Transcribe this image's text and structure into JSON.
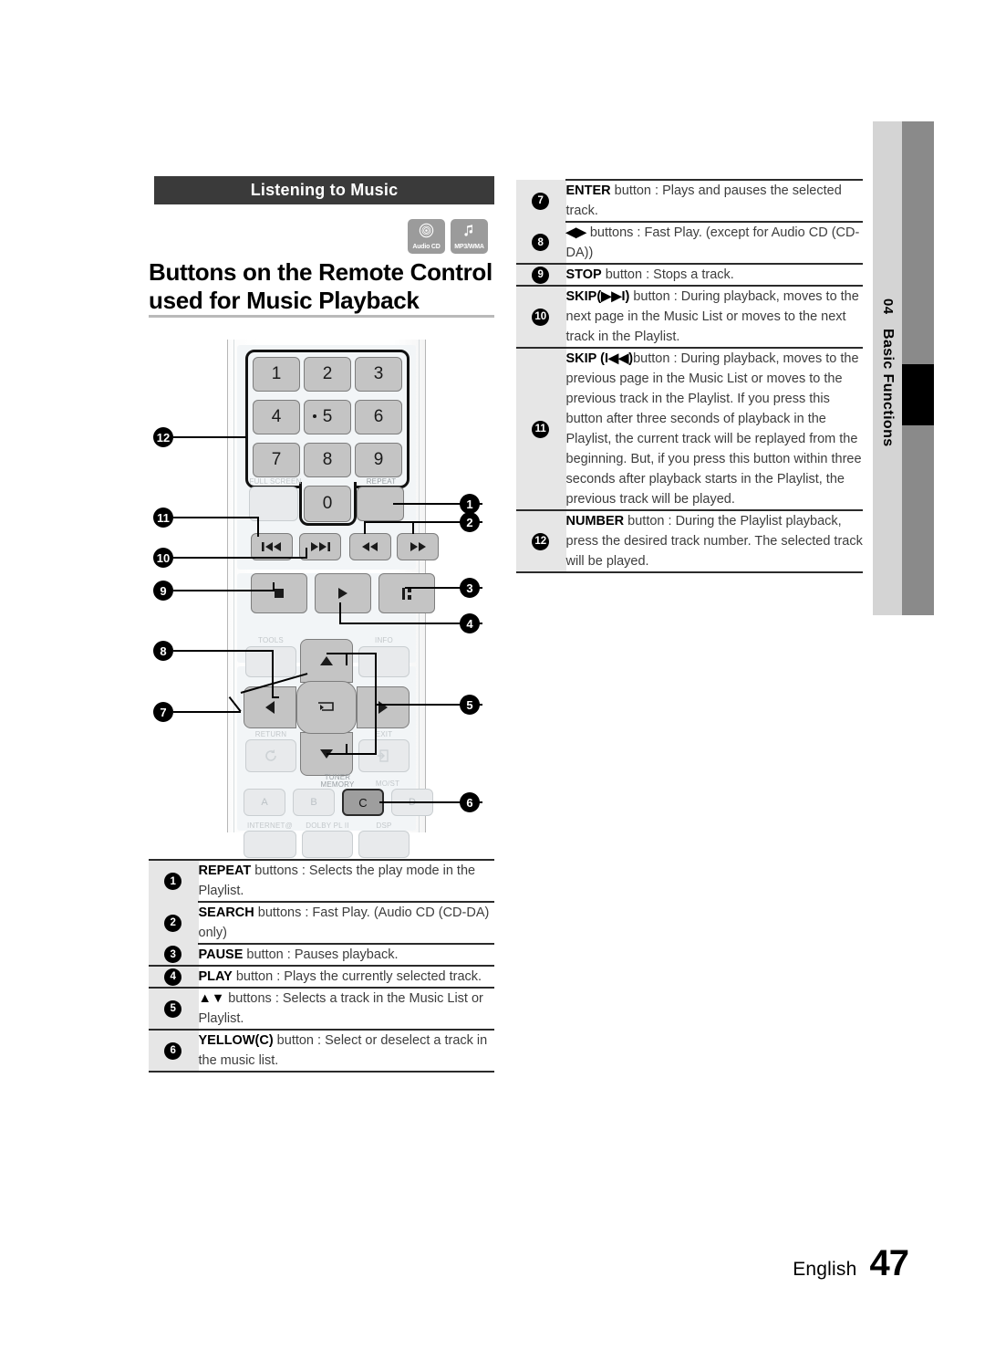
{
  "sidebar": {
    "chapter_number": "04",
    "chapter_title": "Basic Functions"
  },
  "banner": {
    "label": "Listening to Music"
  },
  "badges": [
    {
      "icon": "audio-cd-icon",
      "label": "Audio CD"
    },
    {
      "icon": "music-note-icon",
      "label": "MP3/WMA"
    }
  ],
  "heading": {
    "line1": "Buttons on the Remote Control",
    "line2": "used for Music Playback"
  },
  "remote": {
    "number_keys": [
      "1",
      "2",
      "3",
      "4",
      "5",
      "6",
      "7",
      "8",
      "9",
      "0"
    ],
    "labels": {
      "full_screen": "FULL SCREEN",
      "repeat": "REPEAT",
      "tools": "TOOLS",
      "info": "INFO",
      "return": "RETURN",
      "exit": "EXIT",
      "tuner_memory": "TUNER\nMEMORY",
      "mo_st": "MO/ST",
      "internet": "INTERNET@",
      "dolby": "DOLBY PL II",
      "dsp": "DSP",
      "color_a": "A",
      "color_b": "B",
      "color_c": "C",
      "color_d": "D"
    },
    "left_callouts": [
      "12",
      "11",
      "10",
      "9",
      "8",
      "7"
    ],
    "right_callouts": [
      "1",
      "2",
      "3",
      "4",
      "5",
      "6"
    ]
  },
  "table_left": {
    "rows": [
      {
        "num": "1",
        "bold": "REPEAT",
        "rest": " buttons : Selects the play mode in the Playlist."
      },
      {
        "num": "2",
        "bold": "SEARCH",
        "rest": " buttons : Fast Play. (Audio CD (CD-DA) only)"
      },
      {
        "num": "3",
        "bold": "PAUSE",
        "rest": " button : Pauses playback."
      },
      {
        "num": "4",
        "bold": "PLAY",
        "rest": " button : Plays the currently selected track."
      },
      {
        "num": "5",
        "bold": "▲▼",
        "rest": " buttons : Selects a track in the Music List or Playlist."
      },
      {
        "num": "6",
        "bold": "YELLOW(C)",
        "rest": " button : Select or deselect a track in the music list."
      }
    ]
  },
  "table_right": {
    "rows": [
      {
        "num": "7",
        "bold": "ENTER",
        "rest": " button : Plays and pauses the selected track."
      },
      {
        "num": "8",
        "bold": "◀▶",
        "rest": " buttons : Fast Play. (except for Audio CD (CD-DA))"
      },
      {
        "num": "9",
        "bold": "STOP",
        "rest": " button : Stops a track."
      },
      {
        "num": "10",
        "bold": "SKIP(▶▶I)",
        "rest": " button : During playback, moves to the next page in the Music List or moves to the next track in the Playlist."
      },
      {
        "num": "11",
        "bold": "SKIP (I◀◀)",
        "rest": "button : During playback, moves to the previous page in the Music List or moves to the previous track in the Playlist. If you press this button after three seconds of playback in the Playlist, the current track will be replayed from the beginning. But, if you press this button within three seconds after playback starts in the Playlist, the previous track will be played."
      },
      {
        "num": "12",
        "bold": "NUMBER",
        "rest": " button : During the Playlist playback, press the desired track number. The selected track will be played."
      }
    ]
  },
  "footer": {
    "language": "English",
    "page_number": "47"
  }
}
